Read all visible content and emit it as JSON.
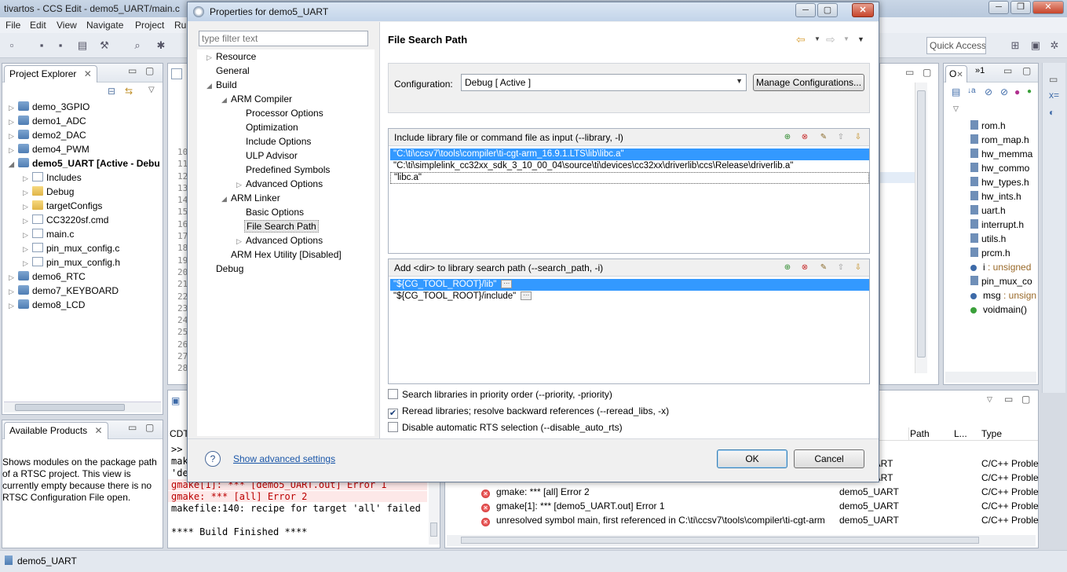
{
  "main_window": {
    "title": "tivartos - CCS Edit - demo5_UART/main.c",
    "menu": [
      "File",
      "Edit",
      "View",
      "Navigate",
      "Project",
      "Ru"
    ],
    "quick_access": "Quick Access",
    "status": "demo5_UART"
  },
  "project_explorer": {
    "tab": "Project Explorer",
    "items": [
      {
        "label": "demo_3GPIO"
      },
      {
        "label": "demo1_ADC"
      },
      {
        "label": "demo2_DAC"
      },
      {
        "label": "demo4_PWM"
      },
      {
        "label": "demo5_UART  [Active - Debu"
      },
      {
        "label": "Includes"
      },
      {
        "label": "Debug"
      },
      {
        "label": "targetConfigs"
      },
      {
        "label": "CC3220sf.cmd"
      },
      {
        "label": "main.c"
      },
      {
        "label": "pin_mux_config.c"
      },
      {
        "label": "pin_mux_config.h"
      },
      {
        "label": "demo6_RTC"
      },
      {
        "label": "demo7_KEYBOARD"
      },
      {
        "label": "demo8_LCD"
      }
    ]
  },
  "editor": {
    "line_numbers": [
      "10",
      "11",
      "12",
      "13",
      "14",
      "15",
      "16",
      "17",
      "18",
      "19",
      "20",
      "21",
      "22",
      "23",
      "24",
      "25",
      "26",
      "27",
      "28"
    ]
  },
  "available_products": {
    "tab": "Available Products",
    "text": "Shows modules on the package path of a RTSC project. This view is currently empty because there is no RTSC Configuration File open."
  },
  "console": {
    "tab": "CDT",
    "lines": [
      ">>",
      "make",
      "'de",
      "gmake[1]: *** [demo5_UART.out] Error 1",
      "gmake: *** [all] Error 2",
      "makefile:140: recipe for target 'all' failed",
      "",
      "**** Build Finished ****"
    ]
  },
  "problems": {
    "columns": [
      "Path",
      "L...",
      "Type"
    ],
    "rows": [
      {
        "desc": "",
        "resource": "UART",
        "type": "C/C++ Proble"
      },
      {
        "desc": "",
        "resource": "UART",
        "type": "C/C++ Proble"
      },
      {
        "desc": "gmake: *** [all] Error 2",
        "resource": "demo5_UART",
        "type": "C/C++ Proble"
      },
      {
        "desc": "gmake[1]: *** [demo5_UART.out] Error 1",
        "resource": "demo5_UART",
        "type": "C/C++ Proble"
      },
      {
        "desc": "unresolved symbol main, first referenced in C:\\ti\\ccsv7\\tools\\compiler\\ti-cgt-arm",
        "resource": "demo5_UART",
        "type": "C/C++ Proble"
      }
    ]
  },
  "outline": {
    "tabs": [
      "O",
      "»1"
    ],
    "items": [
      {
        "label": "rom.h"
      },
      {
        "label": "rom_map.h"
      },
      {
        "label": "hw_memma"
      },
      {
        "label": "hw_commo"
      },
      {
        "label": "hw_types.h"
      },
      {
        "label": "hw_ints.h"
      },
      {
        "label": "uart.h"
      },
      {
        "label": "interrupt.h"
      },
      {
        "label": "utils.h"
      },
      {
        "label": "prcm.h"
      },
      {
        "label": "i",
        "suffix": " : unsigned"
      },
      {
        "label": "pin_mux_co"
      },
      {
        "label": "msg",
        "suffix": " : unsign"
      },
      {
        "label": "voidmain()"
      }
    ]
  },
  "dialog": {
    "title": "Properties for demo5_UART",
    "filter_placeholder": "type filter text",
    "tree": [
      {
        "label": "Resource"
      },
      {
        "label": "General"
      },
      {
        "label": "Build"
      },
      {
        "label": "ARM Compiler"
      },
      {
        "label": "Processor Options"
      },
      {
        "label": "Optimization"
      },
      {
        "label": "Include Options"
      },
      {
        "label": "ULP Advisor"
      },
      {
        "label": "Predefined Symbols"
      },
      {
        "label": "Advanced Options"
      },
      {
        "label": "ARM Linker"
      },
      {
        "label": "Basic Options"
      },
      {
        "label": "File Search Path"
      },
      {
        "label": "Advanced Options"
      },
      {
        "label": "ARM Hex Utility  [Disabled]"
      },
      {
        "label": "Debug"
      }
    ],
    "page_title": "File Search Path",
    "configuration_label": "Configuration:",
    "configuration_value": "Debug  [ Active ]",
    "manage_button": "Manage Configurations...",
    "library_group": {
      "title": "Include library file or command file as input (--library, -l)",
      "items": [
        "\"C:\\ti\\ccsv7\\tools\\compiler\\ti-cgt-arm_16.9.1.LTS\\lib\\libc.a\"",
        "\"C:\\ti\\simplelink_cc32xx_sdk_3_10_00_04\\source\\ti\\devices\\cc32xx\\driverlib\\ccs\\Release\\driverlib.a\"",
        "\"libc.a\""
      ]
    },
    "search_group": {
      "title": "Add <dir> to library search path (--search_path, -i)",
      "items": [
        "\"${CG_TOOL_ROOT}/lib\"",
        "\"${CG_TOOL_ROOT}/include\""
      ]
    },
    "checkboxes": [
      {
        "label": "Search libraries in priority order (--priority, -priority)",
        "checked": false
      },
      {
        "label": "Reread libraries; resolve backward references (--reread_libs, -x)",
        "checked": true
      },
      {
        "label": "Disable automatic RTS selection (--disable_auto_rts)",
        "checked": false
      }
    ],
    "advanced_link": "Show advanced settings",
    "ok_button": "OK",
    "cancel_button": "Cancel"
  }
}
